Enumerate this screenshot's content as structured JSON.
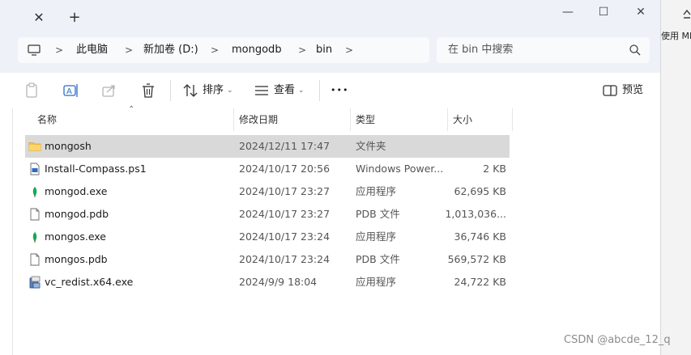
{
  "titlebar": {
    "tab_close": "✕",
    "tab_new": "+",
    "minimize": "—",
    "maximize": "☐",
    "close": "✕"
  },
  "breadcrumb": {
    "items": [
      "此电脑",
      "新加卷 (D:)",
      "mongodb",
      "bin"
    ]
  },
  "search": {
    "placeholder": "在 bin 中搜索"
  },
  "toolbar": {
    "sort_label": "排序",
    "view_label": "查看",
    "more_label": "•••",
    "preview_label": "预览"
  },
  "columns": {
    "name": "名称",
    "modified": "修改日期",
    "type": "类型",
    "size": "大小"
  },
  "files": [
    {
      "name": "mongosh",
      "modified": "2024/12/11 17:47",
      "type": "文件夹",
      "size": "",
      "icon": "folder-icon"
    },
    {
      "name": "Install-Compass.ps1",
      "modified": "2024/10/17 20:56",
      "type": "Windows Power...",
      "size": "2 KB",
      "icon": "powershell-script-icon"
    },
    {
      "name": "mongod.exe",
      "modified": "2024/10/17 23:27",
      "type": "应用程序",
      "size": "62,695 KB",
      "icon": "mongodb-leaf-icon"
    },
    {
      "name": "mongod.pdb",
      "modified": "2024/10/17 23:27",
      "type": "PDB 文件",
      "size": "1,013,036...",
      "icon": "file-icon"
    },
    {
      "name": "mongos.exe",
      "modified": "2024/10/17 23:24",
      "type": "应用程序",
      "size": "36,746 KB",
      "icon": "mongodb-leaf-icon"
    },
    {
      "name": "mongos.pdb",
      "modified": "2024/10/17 23:24",
      "type": "PDB 文件",
      "size": "569,572 KB",
      "icon": "file-icon"
    },
    {
      "name": "vc_redist.x64.exe",
      "modified": "2024/9/9 18:04",
      "type": "应用程序",
      "size": "24,722 KB",
      "icon": "installer-icon"
    }
  ],
  "side_window": {
    "text": "使用 MD"
  },
  "watermark": {
    "text": "CSDN @abcde_12_q"
  },
  "colors": {
    "selected_row": "#d9d9d9",
    "folder": "#f4c245",
    "mongodb_leaf": "#13aa52"
  }
}
